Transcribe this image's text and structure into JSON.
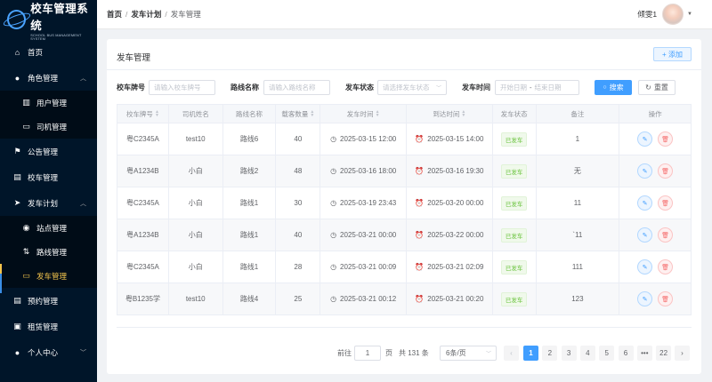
{
  "app": {
    "title": "校车管理系统",
    "subtitle": "SCHOOL BUS MANAGEMENT SYSTEM"
  },
  "sidebar": {
    "items": [
      {
        "label": "首页",
        "icon": "home-icon"
      },
      {
        "label": "角色管理",
        "icon": "user-icon",
        "expanded": true
      },
      {
        "label": "用户管理",
        "icon": "id-card-icon"
      },
      {
        "label": "司机管理",
        "icon": "folder-icon"
      },
      {
        "label": "公告管理",
        "icon": "flag-icon"
      },
      {
        "label": "校车管理",
        "icon": "document-icon"
      },
      {
        "label": "发车计划",
        "icon": "send-icon",
        "expanded": true
      },
      {
        "label": "站点管理",
        "icon": "location-icon"
      },
      {
        "label": "路线管理",
        "icon": "route-icon"
      },
      {
        "label": "发车管理",
        "icon": "bus-icon",
        "active": true
      },
      {
        "label": "预约管理",
        "icon": "document-icon"
      },
      {
        "label": "租赁管理",
        "icon": "wallet-icon"
      },
      {
        "label": "个人中心",
        "icon": "user-icon"
      }
    ]
  },
  "header": {
    "breadcrumb": [
      "首页",
      "发车计划",
      "发车管理"
    ],
    "username": "倾雯1"
  },
  "page": {
    "title": "发车管理",
    "add_label": "+ 添加"
  },
  "filters": {
    "plate_label": "校车牌号",
    "plate_placeholder": "请输入校车牌号",
    "route_label": "路线名称",
    "route_placeholder": "请输入路线名称",
    "status_label": "发车状态",
    "status_placeholder": "请选择发车状态",
    "time_label": "发车时间",
    "start_placeholder": "开始日期",
    "range_sep": "-",
    "end_placeholder": "结束日期",
    "search_label": "搜索",
    "reset_label": "重置"
  },
  "table": {
    "headers": [
      "校车牌号",
      "司机姓名",
      "路线名称",
      "载客数量",
      "发车时间",
      "到达时间",
      "发车状态",
      "备注",
      "操作"
    ],
    "rows": [
      {
        "plate": "粤C2345A",
        "driver": "test10",
        "route": "路线6",
        "passengers": "40",
        "depart": "2025-03-15 12:00",
        "arrive": "2025-03-15 14:00",
        "status": "已发车",
        "note": "1"
      },
      {
        "plate": "粤A1234B",
        "driver": "小白",
        "route": "路线2",
        "passengers": "48",
        "depart": "2025-03-16 18:00",
        "arrive": "2025-03-16 19:30",
        "status": "已发车",
        "note": "无"
      },
      {
        "plate": "粤C2345A",
        "driver": "小白",
        "route": "路线1",
        "passengers": "30",
        "depart": "2025-03-19 23:43",
        "arrive": "2025-03-20 00:00",
        "status": "已发车",
        "note": "11"
      },
      {
        "plate": "粤A1234B",
        "driver": "小白",
        "route": "路线1",
        "passengers": "40",
        "depart": "2025-03-21 00:00",
        "arrive": "2025-03-22 00:00",
        "status": "已发车",
        "note": "`11"
      },
      {
        "plate": "粤C2345A",
        "driver": "小白",
        "route": "路线1",
        "passengers": "28",
        "depart": "2025-03-21 00:09",
        "arrive": "2025-03-21 02:09",
        "status": "已发车",
        "note": "111"
      },
      {
        "plate": "粤B1235学",
        "driver": "test10",
        "route": "路线4",
        "passengers": "25",
        "depart": "2025-03-21 00:12",
        "arrive": "2025-03-21 00:20",
        "status": "已发车",
        "note": "123"
      }
    ]
  },
  "pagination": {
    "goto_prefix": "前往",
    "goto_value": "1",
    "goto_suffix": "页",
    "total_text": "共 131 条",
    "page_size": "6条/页",
    "pages": [
      "1",
      "2",
      "3",
      "4",
      "5",
      "6",
      "•••",
      "22"
    ],
    "current": "1"
  },
  "colors": {
    "sidebar_bg": "#001529",
    "active_menu": "#f3c44c",
    "primary": "#409eff",
    "success": "#67c23a",
    "danger": "#f56c6c"
  }
}
